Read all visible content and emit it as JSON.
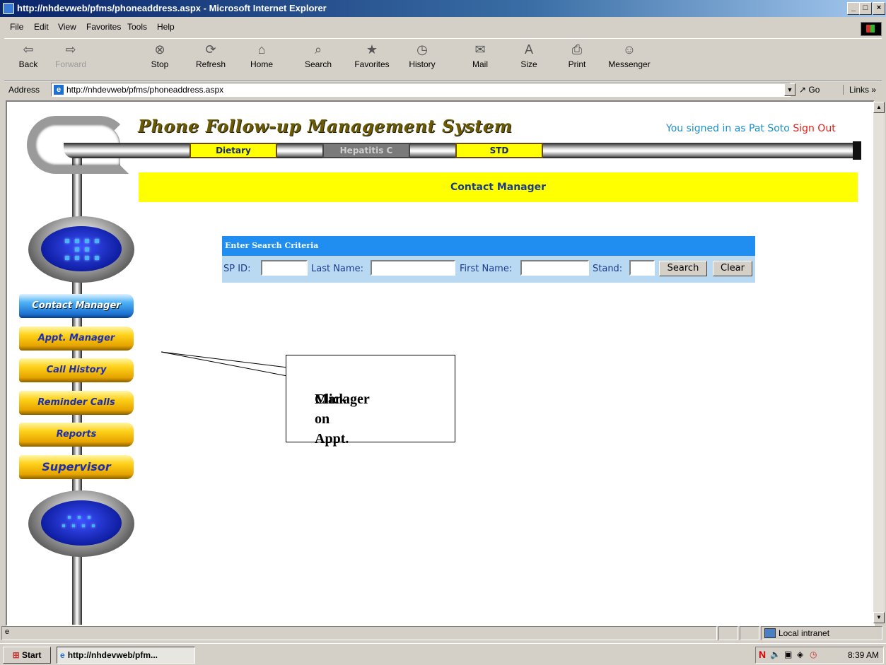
{
  "window": {
    "title": "http://nhdevweb/pfms/phoneaddress.aspx - Microsoft Internet Explorer",
    "controls": [
      "_",
      "□",
      "×"
    ]
  },
  "menu": [
    "File",
    "Edit",
    "View",
    "Favorites",
    "Tools",
    "Help"
  ],
  "toolbar": [
    {
      "label": "Back",
      "icon": "back-arrow-icon",
      "glyph": "⇦"
    },
    {
      "label": "Forward",
      "icon": "forward-arrow-icon",
      "glyph": "⇨"
    },
    {
      "label": "Stop",
      "icon": "stop-icon",
      "glyph": "⊗"
    },
    {
      "label": "Refresh",
      "icon": "refresh-icon",
      "glyph": "⟳"
    },
    {
      "label": "Home",
      "icon": "home-icon",
      "glyph": "⌂"
    },
    {
      "label": "Search",
      "icon": "search-icon",
      "glyph": "⌕"
    },
    {
      "label": "Favorites",
      "icon": "favorites-icon",
      "glyph": "★"
    },
    {
      "label": "History",
      "icon": "history-icon",
      "glyph": "◷"
    },
    {
      "label": "Mail",
      "icon": "mail-icon",
      "glyph": "✉"
    },
    {
      "label": "Size",
      "icon": "font-size-icon",
      "glyph": "A"
    },
    {
      "label": "Print",
      "icon": "print-icon",
      "glyph": "⎙"
    },
    {
      "label": "Messenger",
      "icon": "messenger-icon",
      "glyph": "☺"
    }
  ],
  "address": {
    "label": "Address",
    "url": "http://nhdevweb/pfms/phoneaddress.aspx",
    "go": "Go",
    "links": "Links »"
  },
  "app": {
    "title": "Phone Follow-up Management System",
    "signed_in_text": "You signed in as Pat Soto",
    "sign_out": "Sign Out",
    "tabs": [
      "Dietary",
      "Hepatitis C",
      "STD"
    ],
    "banner": "Contact Manager"
  },
  "search": {
    "header": "Enter Search Criteria",
    "sp_id_label": "SP ID:",
    "last_name_label": "Last Name:",
    "first_name_label": "First Name:",
    "stand_label": "Stand:",
    "search_button": "Search",
    "clear_button": "Clear"
  },
  "sidenav": [
    "Contact Manager",
    "Appt. Manager",
    "Call History",
    "Reminder Calls",
    "Reports",
    "Supervisor"
  ],
  "callout": {
    "line1": "Click on Appt.",
    "line2": "Manager"
  },
  "status": {
    "zone": "Local intranet"
  },
  "taskbar": {
    "start": "Start",
    "task": "http://nhdevweb/pfm...",
    "clock": "8:39 AM"
  },
  "colors": {
    "banner": "#ffff00",
    "search_header": "#1f8ef0",
    "sign_out": "#e0201b",
    "signed_text": "#1e8fc6"
  }
}
